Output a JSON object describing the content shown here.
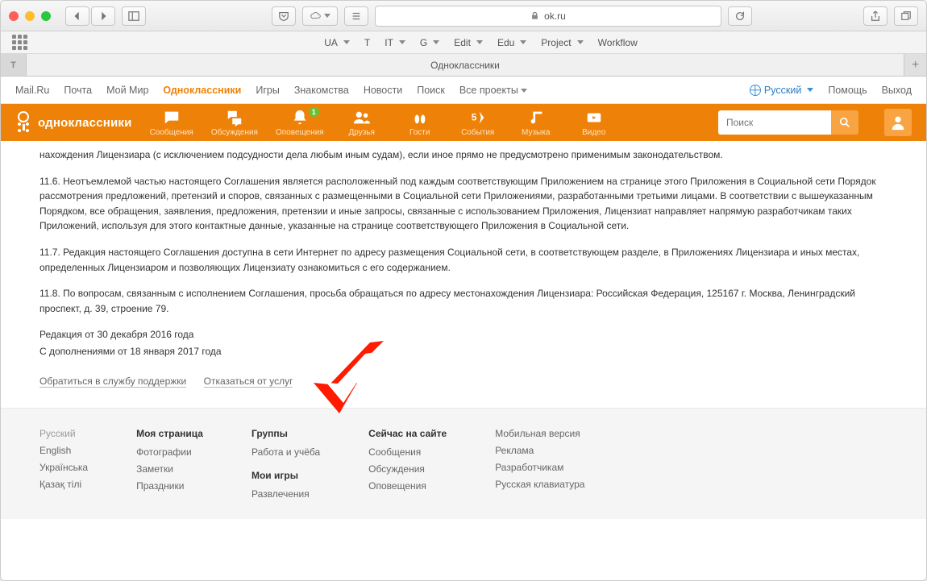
{
  "browser": {
    "url_host": "ok.ru",
    "bookmarks": [
      "UA",
      "T",
      "IT",
      "G",
      "Edit",
      "Edu",
      "Project",
      "Workflow"
    ],
    "tab_title": "Одноклассники"
  },
  "topnav": {
    "items": [
      "Mail.Ru",
      "Почта",
      "Мой Мир",
      "Одноклассники",
      "Игры",
      "Знакомства",
      "Новости",
      "Поиск",
      "Все проекты"
    ],
    "active_index": 3,
    "language": "Русский",
    "help": "Помощь",
    "logout": "Выход"
  },
  "orangenav": {
    "brand": "одноклассники",
    "items": [
      {
        "label": "Сообщения"
      },
      {
        "label": "Обсуждения"
      },
      {
        "label": "Оповещения",
        "badge": "1"
      },
      {
        "label": "Друзья"
      },
      {
        "label": "Гости"
      },
      {
        "label": "События"
      },
      {
        "label": "Музыка"
      },
      {
        "label": "Видео"
      }
    ],
    "search_placeholder": "Поиск"
  },
  "body": {
    "p0": "нахождения Лицензиара (с исключением подсудности дела любым иным судам), если иное прямо не предусмотрено применимым законодательством.",
    "p1": "11.6. Неотъемлемой частью настоящего Соглашения является расположенный под каждым соответствующим Приложением на странице этого Приложения в Социальной сети Порядок рассмотрения предложений, претензий и споров, связанных с размещенными в Социальной сети Приложениями, разработанными третьими лицами. В соответствии с вышеуказанным Порядком, все обращения, заявления, предложения, претензии и иные запросы, связанные с использованием Приложения, Лицензиат направляет напрямую разработчикам таких Приложений, используя для этого контактные данные, указанные на странице соответствующего Приложения в Социальной сети.",
    "p2": "11.7. Редакция настоящего Соглашения доступна в сети Интернет по адресу размещения Социальной сети, в соответствующем разделе, в Приложениях Лицензиара и иных местах, определенных Лицензиаром и позволяющих Лицензиату ознакомиться с его содержанием.",
    "p3": "11.8. По вопросам, связанным с исполнением Соглашения, просьба обращаться по адресу местонахождения Лицензиара: Российская Федерация, 125167 г. Москва, Ленинградский проспект, д. 39, строение 79.",
    "p4": "Редакция от 30 декабря 2016 года",
    "p5": "С дополнениями от 18 января 2017 года",
    "link_support": "Обратиться в службу поддержки",
    "link_optout": "Отказаться от услуг"
  },
  "footer": {
    "langs": [
      "Русский",
      "English",
      "Українська",
      "Қазақ тілі"
    ],
    "col1": {
      "h": "Моя страница",
      "items": [
        "Фотографии",
        "Заметки",
        "Праздники"
      ]
    },
    "col2": {
      "h": "Группы",
      "items": [
        "Работа и учёба"
      ],
      "h2": "Мои игры",
      "items2": [
        "Развлечения"
      ]
    },
    "col3": {
      "h": "Сейчас на сайте",
      "items": [
        "Сообщения",
        "Обсуждения",
        "Оповещения"
      ]
    },
    "col4": {
      "items": [
        "Мобильная версия",
        "Реклама",
        "Разработчикам",
        "Русская клавиатура"
      ]
    }
  }
}
